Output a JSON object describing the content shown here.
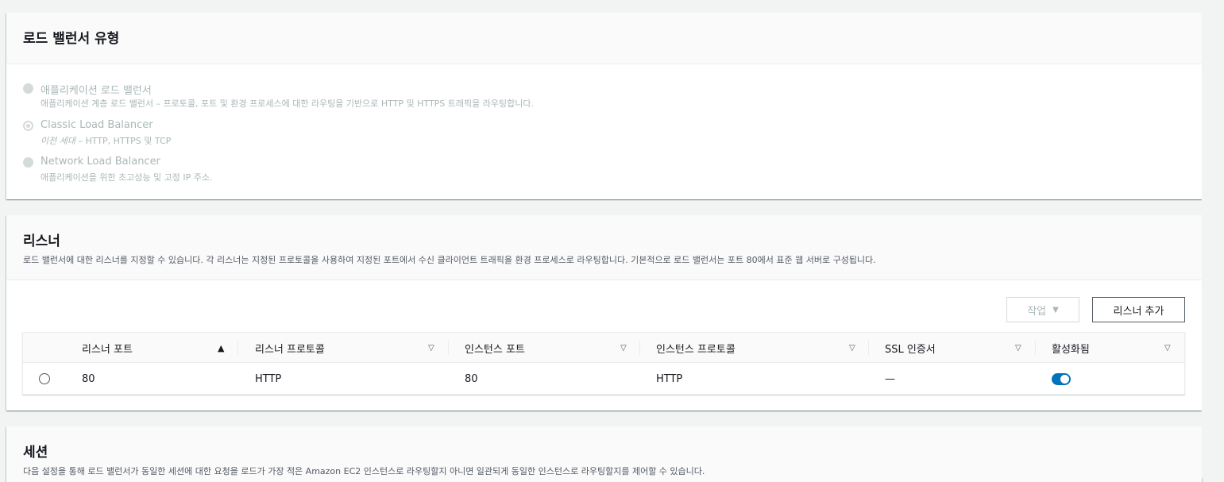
{
  "lb_type": {
    "title": "로드 밸런서 유형",
    "options": [
      {
        "label": "애플리케이션 로드 밸런서",
        "desc": "애플리케이션 계층 로드 밸런서 – 프로토콜, 포트 및 환경 프로세스에 대한 라우팅을 기반으로 HTTP 및 HTTPS 트래픽을 라우팅합니다."
      },
      {
        "label": "Classic Load Balancer",
        "desc_italic": "이전 세대",
        "desc": " – HTTP, HTTPS 및 TCP"
      },
      {
        "label": "Network Load Balancer",
        "desc": "애플리케이션을 위한 초고성능 및 고정 IP 주소."
      }
    ]
  },
  "listeners": {
    "title": "리스너",
    "desc": "로드 밸런서에 대한 리스너를 지정할 수 있습니다. 각 리스너는 지정된 프로토콜을 사용하여 지정된 포트에서 수신 클라이언트 트래픽을 환경 프로세스로 라우팅합니다. 기본적으로 로드 밸런서는 포트 80에서 표준 웹 서버로 구성됩니다.",
    "actions_label": "작업",
    "add_label": "리스너 추가",
    "columns": [
      "리스너 포트",
      "리스너 프로토콜",
      "인스턴스 포트",
      "인스턴스 프로토콜",
      "SSL 인증서",
      "활성화됨"
    ],
    "rows": [
      {
        "listener_port": "80",
        "listener_protocol": "HTTP",
        "instance_port": "80",
        "instance_protocol": "HTTP",
        "ssl": "—",
        "enabled": true
      }
    ]
  },
  "sessions": {
    "title": "세션",
    "desc": "다음 설정을 통해 로드 밸런서가 동일한 세션에 대한 요청을 로드가 가장 적은 Amazon EC2 인스턴스로 라우팅할지 아니면 일관되게 동일한 인스턴스로 라우팅할지를 제어할 수 있습니다."
  }
}
